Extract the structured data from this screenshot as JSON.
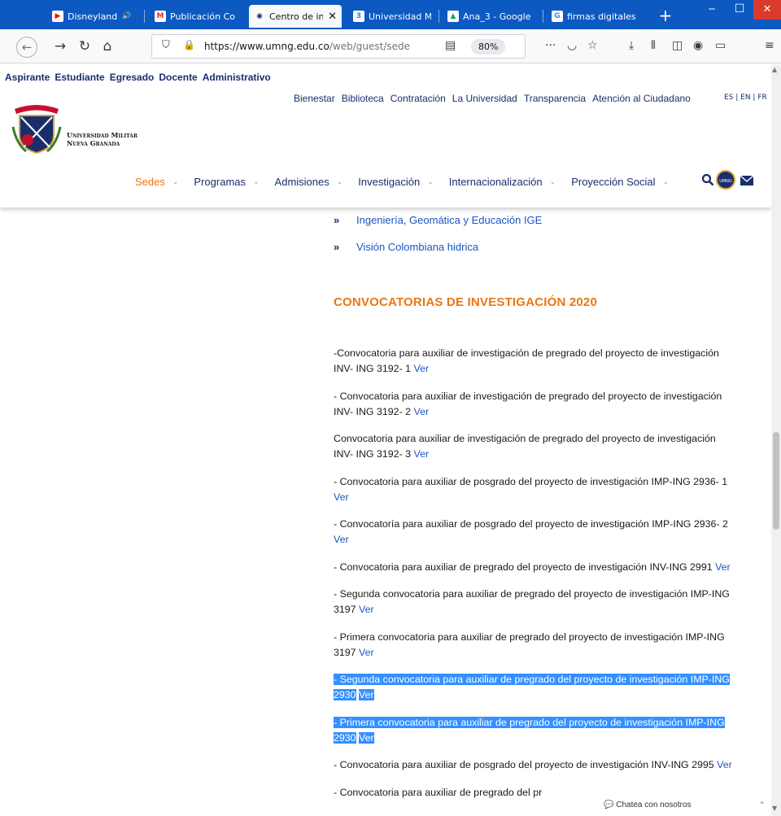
{
  "browser": {
    "tabs": [
      {
        "label": "Disneyland",
        "icon": "youtube-icon",
        "color": "#ff0000",
        "active": false,
        "audio": true
      },
      {
        "label": "Publicación Co",
        "icon": "gmail-icon",
        "color": "#d93025",
        "active": false
      },
      {
        "label": "Centro de in",
        "icon": "umng-icon",
        "color": "#1a2e6c",
        "active": true
      },
      {
        "label": "Universidad Mi",
        "icon": "bookmark-3-icon",
        "color": "#2b7de9",
        "active": false
      },
      {
        "label": "Ana_3 - Google",
        "icon": "google-drive-icon",
        "color": "#1fa463",
        "active": false
      },
      {
        "label": "firmas digitales",
        "icon": "google-icon",
        "color": "#4285f4",
        "active": false
      }
    ],
    "new_tab": "+",
    "url_host": "https://www.umng.edu.co",
    "url_path": "/web/guest/sede",
    "zoom": "80%"
  },
  "header": {
    "top_links": [
      "Aspirante",
      "Estudiante",
      "Egresado",
      "Docente",
      "Administrativo"
    ],
    "util_links": [
      "Bienestar",
      "Biblioteca",
      "Contratación",
      "La Universidad",
      "Transparencia",
      "Atención al Ciudadano"
    ],
    "languages": "ES | EN | FR",
    "logo_line1": "Universidad Militar",
    "logo_line2": "Nueva Granada",
    "nav": [
      {
        "label": "Sedes",
        "current": true
      },
      {
        "label": "Programas",
        "current": false
      },
      {
        "label": "Admisiones",
        "current": false
      },
      {
        "label": "Investigación",
        "current": false
      },
      {
        "label": "Internacionalización",
        "current": false
      },
      {
        "label": "Proyección Social",
        "current": false
      }
    ],
    "radio_label": "UMNG RADIO"
  },
  "content": {
    "sublinks": [
      "Ingeniería, Geomática y Educación IGE",
      "Visión Colombiana hidrica"
    ],
    "section_title": "CONVOCATORIAS DE INVESTIGACIÓN 2020",
    "ver_label": "Ver",
    "calls": [
      {
        "text": "-Convocatoria para auxiliar de investigación de pregrado del proyecto de investigación INV- ING 3192- 1",
        "selected": false
      },
      {
        "text": "- Convocatoria para auxiliar de investigación de pregrado del proyecto de investigación INV- ING 3192- 2",
        "selected": false
      },
      {
        "text": "Convocatoria para auxiliar de investigación de pregrado del proyecto de investigación INV- ING 3192- 3",
        "selected": false
      },
      {
        "text": "- Convocatoria para auxiliar de posgrado del proyecto de investigación IMP-ING 2936- 1",
        "selected": false
      },
      {
        "text": "- Convocatoría para auxiliar de posgrado del proyecto de investigación IMP-ING 2936- 2",
        "selected": false
      },
      {
        "text": "- Convocatoria para auxiliar de pregrado  del proyecto de investigación  INV-ING 2991",
        "selected": false
      },
      {
        "text": "- Segunda convocatoria para auxiliar de pregrado  del proyecto de investigación  IMP-ING 3197",
        "selected": false
      },
      {
        "text": "- Primera convocatoria para auxiliar de pregrado  del proyecto de investigación  IMP-ING 3197",
        "selected": false
      },
      {
        "text": "- Segunda convocatoria para auxiliar de pregrado  del proyecto de investigación  IMP-ING 2930",
        "selected": true
      },
      {
        "text": "- Primera convocatoria para auxiliar de pregrado  del proyecto de investigación  IMP-ING 2930",
        "selected": true
      },
      {
        "text": "- Convocatoria para auxiliar de posgrado  del proyecto de investigación  INV-ING 2995",
        "selected": false
      },
      {
        "text": "- Convocatoria para auxiliar de pregrado  del pr",
        "selected": false
      }
    ],
    "chat_label": "Chatea con nosotros"
  }
}
